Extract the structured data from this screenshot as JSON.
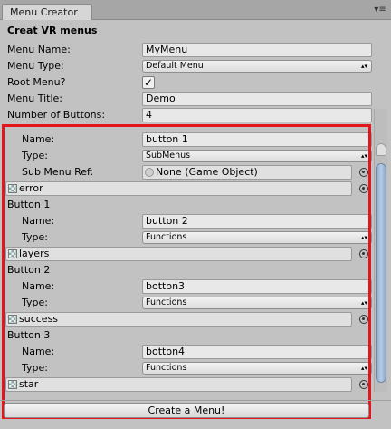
{
  "window": {
    "tab_label": "Menu Creator",
    "tab_menu_glyph": "▾≡"
  },
  "header": {
    "title": "Creat VR menus"
  },
  "top_fields": {
    "menu_name_label": "Menu Name:",
    "menu_name_value": "MyMenu",
    "menu_type_label": "Menu Type:",
    "menu_type_value": "Default Menu",
    "root_menu_label": "Root Menu?",
    "root_menu_checked": true,
    "root_menu_check_glyph": "✓",
    "menu_title_label": "Menu Title:",
    "menu_title_value": "Demo",
    "num_buttons_label": "Number of Buttons:",
    "num_buttons_value": "4"
  },
  "buttons": [
    {
      "heading": "",
      "name_label": "Name:",
      "name_value": "button 1",
      "type_label": "Type:",
      "type_value": "SubMenus",
      "submenu_label": "Sub Menu Ref:",
      "submenu_value": "None (Game Object)",
      "texture": "error"
    },
    {
      "heading": "Button 1",
      "name_label": "Name:",
      "name_value": "button 2",
      "type_label": "Type:",
      "type_value": "Functions",
      "texture": "layers"
    },
    {
      "heading": "Button 2",
      "name_label": "Name:",
      "name_value": "botton3",
      "type_label": "Type:",
      "type_value": "Functions",
      "texture": "success"
    },
    {
      "heading": "Button 3",
      "name_label": "Name:",
      "name_value": "botton4",
      "type_label": "Type:",
      "type_value": "Functions",
      "texture": "star"
    }
  ],
  "dropdown_arrows": "▴▾",
  "create_button_label": "Create a Menu!",
  "colors": {
    "highlight_box": "#e3161e",
    "panel_bg": "#c2c2c2",
    "scroll_thumb": "#9fb7d6"
  }
}
